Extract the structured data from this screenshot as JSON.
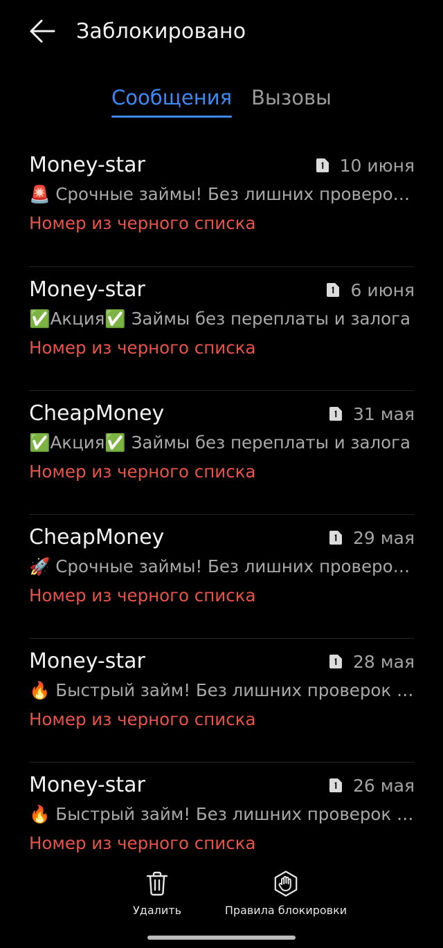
{
  "header": {
    "title": "Заблокировано",
    "back_icon": "arrow-left-icon"
  },
  "tabs": [
    {
      "label": "Сообщения",
      "active": true
    },
    {
      "label": "Вызовы",
      "active": false
    }
  ],
  "colors": {
    "background": "#000000",
    "accent": "#3d8af7",
    "status_red": "#e9534a",
    "secondary_text": "#a9a9a9"
  },
  "messages": [
    {
      "sender": "Money-star",
      "sim_icon": "sim-1-icon",
      "date": "10 июня",
      "preview": "🚨 Срочные займы! Без лишних проверок и справок",
      "status": "Номер из черного списка"
    },
    {
      "sender": "Money-star",
      "sim_icon": "sim-1-icon",
      "date": "6 июня",
      "preview": "✅Акция✅ Займы без переплаты и залога",
      "status": "Номер из черного списка"
    },
    {
      "sender": "CheapMoney",
      "sim_icon": "sim-1-icon",
      "date": "31 мая",
      "preview": "✅Акция✅ Займы без переплаты и залога",
      "status": "Номер из черного списка"
    },
    {
      "sender": "CheapMoney",
      "sim_icon": "sim-1-icon",
      "date": "29 мая",
      "preview": "🚀 Срочные займы! Без лишних проверок и справок",
      "status": "Номер из черного списка"
    },
    {
      "sender": "Money-star",
      "sim_icon": "sim-1-icon",
      "date": "28 мая",
      "preview": "🔥 Быстрый займ! Без лишних проверок и справок",
      "status": "Номер из черного списка"
    },
    {
      "sender": "Money-star",
      "sim_icon": "sim-1-icon",
      "date": "26 мая",
      "preview": "🔥 Быстрый займ! Без лишних проверок и справок",
      "status": "Номер из черного списка"
    }
  ],
  "bottom_bar": {
    "delete_label": "Удалить",
    "delete_icon": "trash-icon",
    "rules_label": "Правила блокировки",
    "rules_icon": "hand-stop-icon"
  }
}
